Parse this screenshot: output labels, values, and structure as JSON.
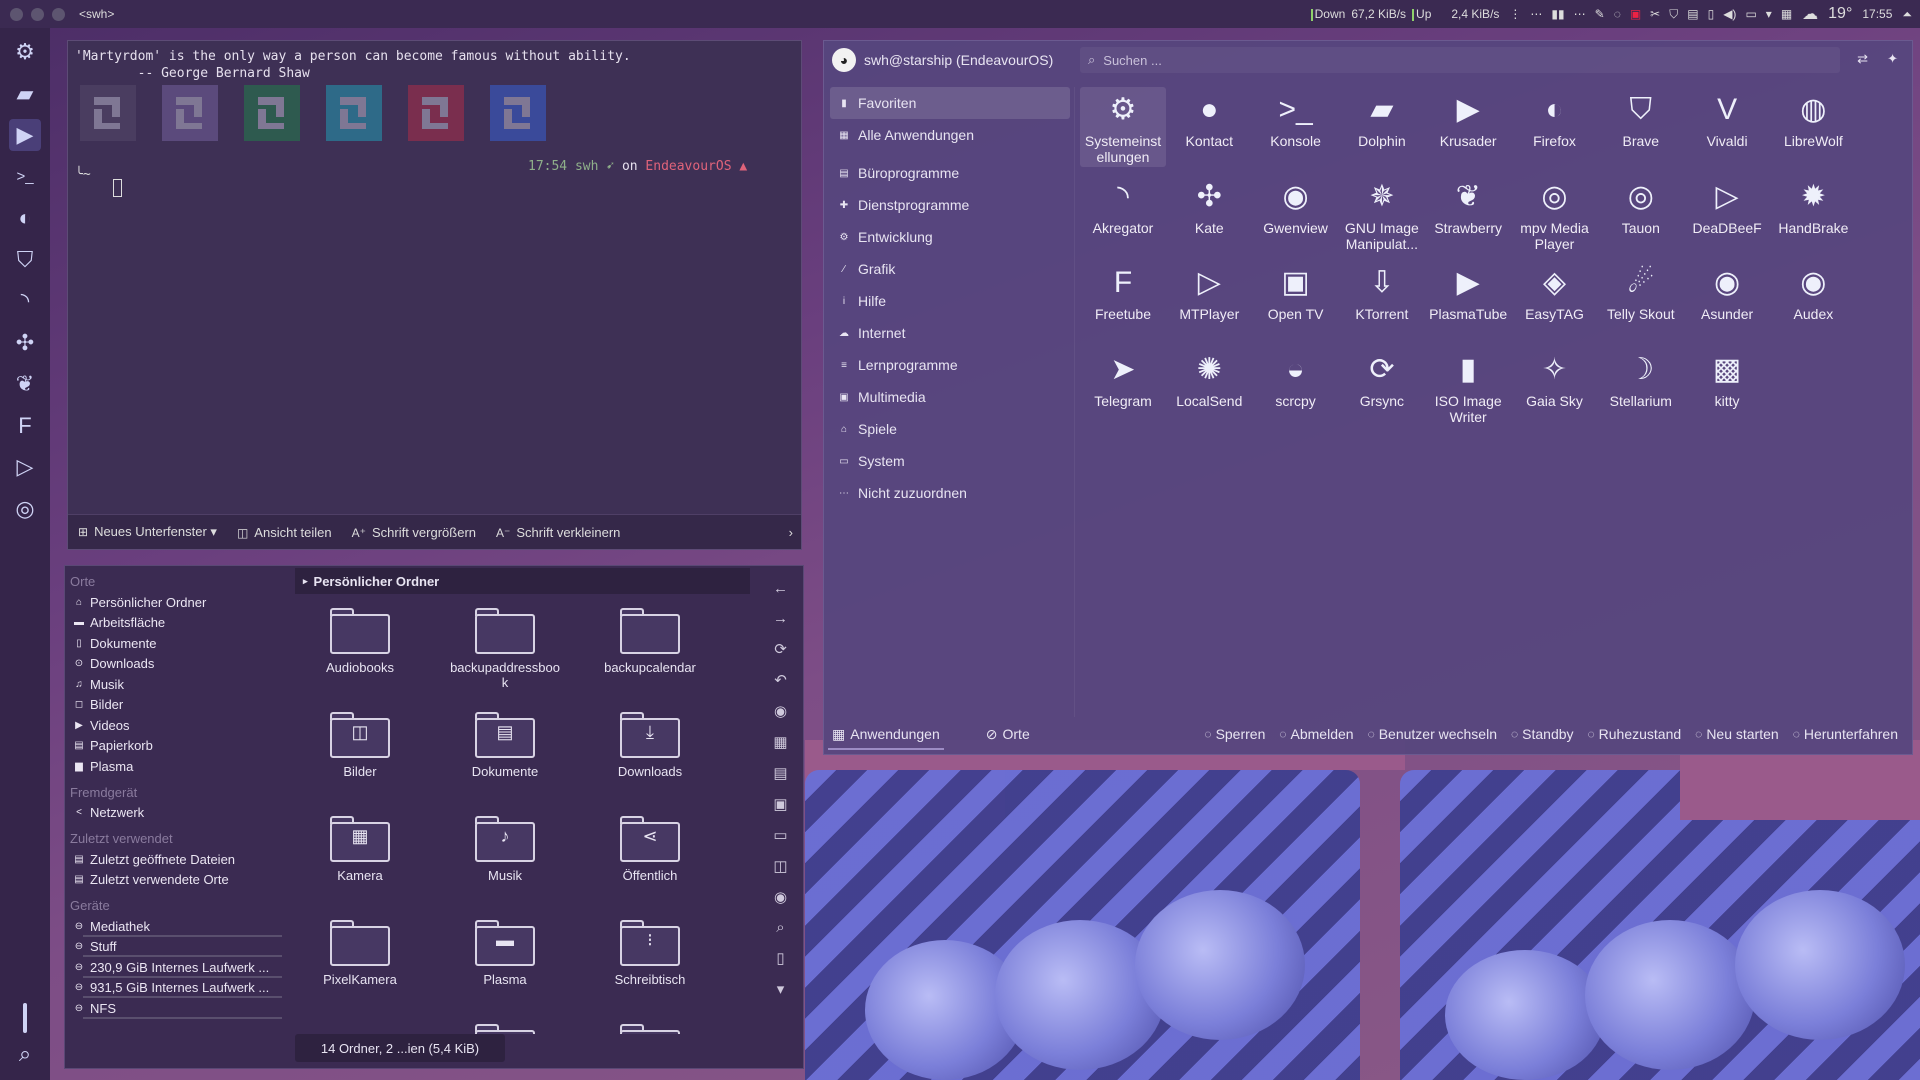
{
  "topbar": {
    "title": "<swh>",
    "down_label": "Down",
    "down_speed": "67,2 KiB/s",
    "up_label": "Up",
    "up_speed": "2,4 KiB/s",
    "temperature": "19°",
    "clock": "17:55"
  },
  "dock": {
    "items": [
      {
        "name": "systemsettings-icon",
        "glyph": "⚙"
      },
      {
        "name": "dolphin-icon",
        "glyph": "▰"
      },
      {
        "name": "krusader-icon",
        "glyph": "▶"
      },
      {
        "name": "konsole-icon",
        "glyph": ">_"
      },
      {
        "name": "firefox-icon",
        "glyph": "◐"
      },
      {
        "name": "brave-icon",
        "glyph": "⛉"
      },
      {
        "name": "akregator-icon",
        "glyph": "◝"
      },
      {
        "name": "kate-icon",
        "glyph": "✣"
      },
      {
        "name": "strawberry-icon",
        "glyph": "❦"
      },
      {
        "name": "freetube-icon",
        "glyph": "F"
      },
      {
        "name": "mtplayer-icon",
        "glyph": "▷"
      },
      {
        "name": "audex-icon",
        "glyph": "◎"
      }
    ],
    "search_glyph": "⌕"
  },
  "terminal": {
    "quote_line1": "'Martyrdom' is the only way a person can become famous without ability.",
    "quote_line2": "        -- George Bernard Shaw",
    "prompt_time": "17:54",
    "prompt_user": "swh",
    "prompt_on": "on",
    "prompt_os": "EndeavourOS",
    "prompt_path": "~",
    "logo_colors": [
      "#4a3d60",
      "#5b4a7c",
      "#2e5a4f",
      "#2e6a88",
      "#7a2e4e",
      "#3a4a9a"
    ],
    "toolbar": {
      "new_tab": "Neues Unterfenster",
      "split": "Ansicht teilen",
      "font_bigger": "Schrift vergrößern",
      "font_smaller": "Schrift verkleinern"
    }
  },
  "dolphin": {
    "places_header": "Orte",
    "places": [
      {
        "label": "Persönlicher Ordner",
        "icon": "⌂"
      },
      {
        "label": "Arbeitsfläche",
        "icon": "▬"
      },
      {
        "label": "Dokumente",
        "icon": "▯"
      },
      {
        "label": "Downloads",
        "icon": "⊙"
      },
      {
        "label": "Musik",
        "icon": "♫"
      },
      {
        "label": "Bilder",
        "icon": "◻"
      },
      {
        "label": "Videos",
        "icon": "▶"
      },
      {
        "label": "Papierkorb",
        "icon": "▤"
      },
      {
        "label": "Plasma",
        "icon": "▆"
      }
    ],
    "remote_header": "Fremdgerät",
    "remote": [
      {
        "label": "Netzwerk",
        "icon": "<"
      }
    ],
    "recent_header": "Zuletzt verwendet",
    "recent": [
      {
        "label": "Zuletzt geöffnete Dateien",
        "icon": "▤"
      },
      {
        "label": "Zuletzt verwendete Orte",
        "icon": "▤"
      }
    ],
    "devices_header": "Geräte",
    "devices": [
      {
        "label": "Mediathek",
        "icon": "⊖"
      },
      {
        "label": "Stuff",
        "icon": "⊖"
      },
      {
        "label": "230,9 GiB Internes Laufwerk ...",
        "icon": "⊖"
      },
      {
        "label": "931,5 GiB Internes Laufwerk ...",
        "icon": "⊖"
      },
      {
        "label": "NFS",
        "icon": "⊖"
      }
    ],
    "breadcrumb": "Persönlicher Ordner",
    "files": [
      {
        "label": "Audiobooks",
        "emb": ""
      },
      {
        "label": "backupaddressboo\nk",
        "emb": ""
      },
      {
        "label": "backupcalendar",
        "emb": ""
      },
      {
        "label": "Bilder",
        "emb": "◫"
      },
      {
        "label": "Dokumente",
        "emb": "▤"
      },
      {
        "label": "Downloads",
        "emb": "⤓"
      },
      {
        "label": "Kamera",
        "emb": "▦"
      },
      {
        "label": "Musik",
        "emb": "♪"
      },
      {
        "label": "Öffentlich",
        "emb": "⋖"
      },
      {
        "label": "PixelKamera",
        "emb": ""
      },
      {
        "label": "Plasma",
        "emb": "▬"
      },
      {
        "label": "Schreibtisch",
        "emb": "⁝"
      }
    ],
    "status": "14 Ordner, 2 ...ien (5,4 KiB)",
    "side_glyphs": [
      "←",
      "→",
      "⟳",
      "↶",
      "◉",
      "▦",
      "▤",
      "▣",
      "▭",
      "◫",
      "◉",
      "⌕",
      "▯",
      "▾"
    ]
  },
  "launcher": {
    "user": "swh@starship (EndeavourOS)",
    "search_placeholder": "Suchen ...",
    "categories": [
      {
        "label": "Favoriten",
        "icon": "▮",
        "sel": true
      },
      {
        "label": "Alle Anwendungen",
        "icon": "▦"
      },
      {
        "label": "Büroprogramme",
        "icon": "▤"
      },
      {
        "label": "Dienstprogramme",
        "icon": "✚"
      },
      {
        "label": "Entwicklung",
        "icon": "⚙"
      },
      {
        "label": "Grafik",
        "icon": "∕"
      },
      {
        "label": "Hilfe",
        "icon": "i"
      },
      {
        "label": "Internet",
        "icon": "☁"
      },
      {
        "label": "Lernprogramme",
        "icon": "≡"
      },
      {
        "label": "Multimedia",
        "icon": "▣"
      },
      {
        "label": "Spiele",
        "icon": "⌂"
      },
      {
        "label": "System",
        "icon": "▭"
      },
      {
        "label": "Nicht zuzuordnen",
        "icon": "⋯"
      }
    ],
    "apps": [
      {
        "label": "Systemeinst\nellungen",
        "icon": "⚙",
        "sel": true
      },
      {
        "label": "Kontact",
        "icon": "●"
      },
      {
        "label": "Konsole",
        "icon": ">_"
      },
      {
        "label": "Dolphin",
        "icon": "▰"
      },
      {
        "label": "Krusader",
        "icon": "▶"
      },
      {
        "label": "Firefox",
        "icon": "◐"
      },
      {
        "label": "Brave",
        "icon": "⛉"
      },
      {
        "label": "Vivaldi",
        "icon": "V"
      },
      {
        "label": "LibreWolf",
        "icon": "◍"
      },
      {
        "label": "Akregator",
        "icon": "◝"
      },
      {
        "label": "Kate",
        "icon": "✣"
      },
      {
        "label": "Gwenview",
        "icon": "◉"
      },
      {
        "label": "GNU Image\nManipulat...",
        "icon": "✵"
      },
      {
        "label": "Strawberry",
        "icon": "❦"
      },
      {
        "label": "mpv Media\nPlayer",
        "icon": "◎"
      },
      {
        "label": "Tauon",
        "icon": "◎"
      },
      {
        "label": "DeaDBeeF",
        "icon": "▷"
      },
      {
        "label": "HandBrake",
        "icon": "✹"
      },
      {
        "label": "Freetube",
        "icon": "F"
      },
      {
        "label": "MTPlayer",
        "icon": "▷"
      },
      {
        "label": "Open TV",
        "icon": "▣"
      },
      {
        "label": "KTorrent",
        "icon": "⇩"
      },
      {
        "label": "PlasmaTube",
        "icon": "▶"
      },
      {
        "label": "EasyTAG",
        "icon": "◈"
      },
      {
        "label": "Telly Skout",
        "icon": "☄"
      },
      {
        "label": "Asunder",
        "icon": "◉"
      },
      {
        "label": "Audex",
        "icon": "◉"
      },
      {
        "label": "Telegram",
        "icon": "➤"
      },
      {
        "label": "LocalSend",
        "icon": "✺"
      },
      {
        "label": "scrcpy",
        "icon": "◒"
      },
      {
        "label": "Grsync",
        "icon": "⟳"
      },
      {
        "label": "ISO Image\nWriter",
        "icon": "▮"
      },
      {
        "label": "Gaia Sky",
        "icon": "✧"
      },
      {
        "label": "Stellarium",
        "icon": "☽"
      },
      {
        "label": "kitty",
        "icon": "▩"
      }
    ],
    "footer_tabs": [
      {
        "label": "Anwendungen",
        "icon": "▦",
        "sel": true
      },
      {
        "label": "Orte",
        "icon": "⊘"
      }
    ],
    "actions": [
      {
        "label": "Sperren",
        "icon": "◌"
      },
      {
        "label": "Abmelden",
        "icon": "◌"
      },
      {
        "label": "Benutzer wechseln",
        "icon": "◌"
      },
      {
        "label": "Standby",
        "icon": "◌"
      },
      {
        "label": "Ruhezustand",
        "icon": "◌"
      },
      {
        "label": "Neu starten",
        "icon": "◌"
      },
      {
        "label": "Herunterfahren",
        "icon": "◌"
      }
    ]
  }
}
